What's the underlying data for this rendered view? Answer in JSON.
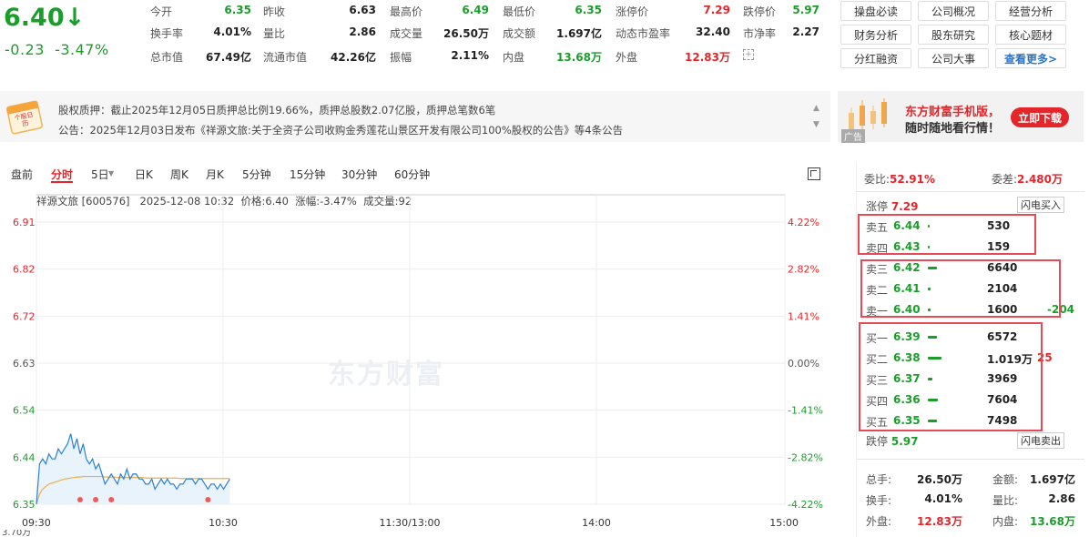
{
  "header": {
    "price": "6.40↓",
    "change": "-0.23",
    "change_pct": "-3.47%",
    "quotes": [
      [
        {
          "label": "今开",
          "value": "6.35",
          "cls": "green"
        },
        {
          "label": "昨收",
          "value": "6.63",
          "cls": "dark"
        },
        {
          "label": "最高价",
          "value": "6.49",
          "cls": "green"
        },
        {
          "label": "最低价",
          "value": "6.35",
          "cls": "green"
        },
        {
          "label": "涨停价",
          "value": "7.29",
          "cls": "red"
        },
        {
          "label": "跌停价",
          "value": "5.97",
          "cls": "green"
        }
      ],
      [
        {
          "label": "换手率",
          "value": "4.01%",
          "cls": "dark"
        },
        {
          "label": "量比",
          "value": "2.86",
          "cls": "dark"
        },
        {
          "label": "成交量",
          "value": "26.50万",
          "cls": "dark"
        },
        {
          "label": "成交额",
          "value": "1.697亿",
          "cls": "dark"
        },
        {
          "label": "动态市盈率",
          "value": "32.40",
          "cls": "dark"
        },
        {
          "label": "市净率",
          "value": "2.27",
          "cls": "dark"
        }
      ],
      [
        {
          "label": "总市值",
          "value": "67.49亿",
          "cls": "dark"
        },
        {
          "label": "流通市值",
          "value": "42.26亿",
          "cls": "dark"
        },
        {
          "label": "振幅",
          "value": "2.11%",
          "cls": "dark"
        },
        {
          "label": "内盘",
          "value": "13.68万",
          "cls": "green"
        },
        {
          "label": "外盘",
          "value": "12.83万",
          "cls": "red"
        }
      ]
    ],
    "buttons": [
      [
        "操盘必读",
        "公司概况",
        "经营分析"
      ],
      [
        "财务分析",
        "股东研究",
        "核心题材"
      ],
      [
        "分红融资",
        "公司大事",
        "查看更多>"
      ]
    ]
  },
  "notice": {
    "icon_label": "个股日历",
    "line1": "股权质押：截止2025年12月05日质押总比例19.66%，质押总股数2.07亿股，质押总笔数6笔",
    "line2": "公告：2025年12月03日发布《祥源文旅:关于全资子公司收购金秀莲花山景区开发有限公司100%股权的公告》等4条公告"
  },
  "ad": {
    "line1": "东方财富手机版，",
    "line2": "随时随地看行情！",
    "button": "立即下载",
    "tag": "广告"
  },
  "tabs": [
    "盘前",
    "分时",
    "5日",
    "日K",
    "周K",
    "月K",
    "5分钟",
    "15分钟",
    "30分钟",
    "60分钟"
  ],
  "chart_info": {
    "name": "祥源文旅 [600576]",
    "time": "2025-12-08 10:32",
    "price_label": "价格:6.40",
    "chg_label": "涨幅:-3.47%",
    "vol_label": "成交量:92",
    "watermark": "东方财富",
    "bottom_label": "3.70万"
  },
  "chart_data": {
    "type": "line",
    "left_ticks": [
      "6.91",
      "6.82",
      "6.72",
      "6.63",
      "6.54",
      "6.44",
      "6.35"
    ],
    "right_ticks": [
      "4.22%",
      "2.82%",
      "1.41%",
      "0.00%",
      "-1.41%",
      "-2.82%",
      "-4.22%"
    ],
    "x_ticks": [
      "09:30",
      "10:30",
      "11:30/13:00",
      "14:00",
      "15:00"
    ],
    "ylim": [
      6.35,
      6.91
    ],
    "prev_close": 6.63,
    "x_minutes": [
      0,
      1,
      2,
      3,
      4,
      5,
      6,
      7,
      8,
      9,
      10,
      11,
      12,
      13,
      14,
      15,
      16,
      17,
      18,
      19,
      20,
      21,
      22,
      23,
      24,
      25,
      26,
      27,
      28,
      29,
      30,
      31,
      32,
      33,
      34,
      35,
      36,
      37,
      38,
      39,
      40,
      41,
      42,
      43,
      44,
      45,
      46,
      47,
      48,
      49,
      50,
      51,
      52,
      53,
      54,
      55,
      56,
      57,
      58,
      59,
      60,
      61,
      62
    ],
    "price": [
      6.35,
      6.43,
      6.44,
      6.43,
      6.45,
      6.44,
      6.44,
      6.46,
      6.45,
      6.46,
      6.47,
      6.49,
      6.46,
      6.48,
      6.45,
      6.47,
      6.44,
      6.43,
      6.44,
      6.42,
      6.43,
      6.41,
      6.39,
      6.4,
      6.41,
      6.4,
      6.39,
      6.41,
      6.4,
      6.42,
      6.4,
      6.41,
      6.41,
      6.4,
      6.4,
      6.39,
      6.39,
      6.4,
      6.38,
      6.39,
      6.4,
      6.39,
      6.4,
      6.39,
      6.39,
      6.38,
      6.39,
      6.39,
      6.4,
      6.4,
      6.4,
      6.39,
      6.4,
      6.4,
      6.39,
      6.38,
      6.39,
      6.39,
      6.38,
      6.39,
      6.38,
      6.39,
      6.4
    ],
    "avg": [
      6.35,
      6.37,
      6.38,
      6.385,
      6.39,
      6.392,
      6.394,
      6.396,
      6.398,
      6.4,
      6.401,
      6.402,
      6.403,
      6.404,
      6.404,
      6.405,
      6.405,
      6.405,
      6.405,
      6.405,
      6.405,
      6.405,
      6.404,
      6.404,
      6.404,
      6.404,
      6.403,
      6.403,
      6.403,
      6.403,
      6.403,
      6.403,
      6.403,
      6.403,
      6.403,
      6.402,
      6.402,
      6.402,
      6.402,
      6.402,
      6.402,
      6.402,
      6.402,
      6.402,
      6.402,
      6.402,
      6.401,
      6.401,
      6.401,
      6.401,
      6.401,
      6.401,
      6.401,
      6.401,
      6.401,
      6.401,
      6.401,
      6.401,
      6.401,
      6.401,
      6.401,
      6.401,
      6.401
    ],
    "markers_minutes": [
      14,
      19,
      24,
      55
    ]
  },
  "orderbook": {
    "wei_bi_label": "委比:",
    "wei_bi": "52.91%",
    "wei_cha_label": "委差:",
    "wei_cha": "2.480万",
    "zhang_ting_label": "涨停",
    "zhang_ting": "7.29",
    "die_ting_label": "跌停",
    "die_ting": "5.97",
    "flash_buy": "闪电买入",
    "flash_sell": "闪电卖出",
    "sells": [
      {
        "label": "卖五",
        "price": "6.44",
        "vol": "530",
        "extra": "",
        "bar": 2
      },
      {
        "label": "卖四",
        "price": "6.43",
        "vol": "159",
        "extra": "",
        "bar": 2
      },
      {
        "label": "卖三",
        "price": "6.42",
        "vol": "6640",
        "extra": "",
        "bar": 10
      },
      {
        "label": "卖二",
        "price": "6.41",
        "vol": "2104",
        "extra": "",
        "bar": 3
      },
      {
        "label": "卖一",
        "price": "6.40",
        "vol": "1600",
        "extra": "-204",
        "bar": 3
      }
    ],
    "buys": [
      {
        "label": "买一",
        "price": "6.39",
        "vol": "6572",
        "extra": "",
        "bar": 10
      },
      {
        "label": "买二",
        "price": "6.38",
        "vol": "1.019万",
        "extra": "25",
        "bar": 15
      },
      {
        "label": "买三",
        "price": "6.37",
        "vol": "3969",
        "extra": "",
        "bar": 5
      },
      {
        "label": "买四",
        "price": "6.36",
        "vol": "7604",
        "extra": "",
        "bar": 11
      },
      {
        "label": "买五",
        "price": "6.35",
        "vol": "7498",
        "extra": "",
        "bar": 10
      }
    ],
    "stats": [
      [
        {
          "label": "总手:",
          "value": "26.50万",
          "cls": "dark"
        },
        {
          "label": "金额:",
          "value": "1.697亿",
          "cls": "dark"
        }
      ],
      [
        {
          "label": "换手:",
          "value": "4.01%",
          "cls": "dark"
        },
        {
          "label": "量比:",
          "value": "2.86",
          "cls": "dark"
        }
      ],
      [
        {
          "label": "外盘:",
          "value": "12.83万",
          "cls": "red"
        },
        {
          "label": "内盘:",
          "value": "13.68万",
          "cls": "green"
        }
      ]
    ]
  }
}
